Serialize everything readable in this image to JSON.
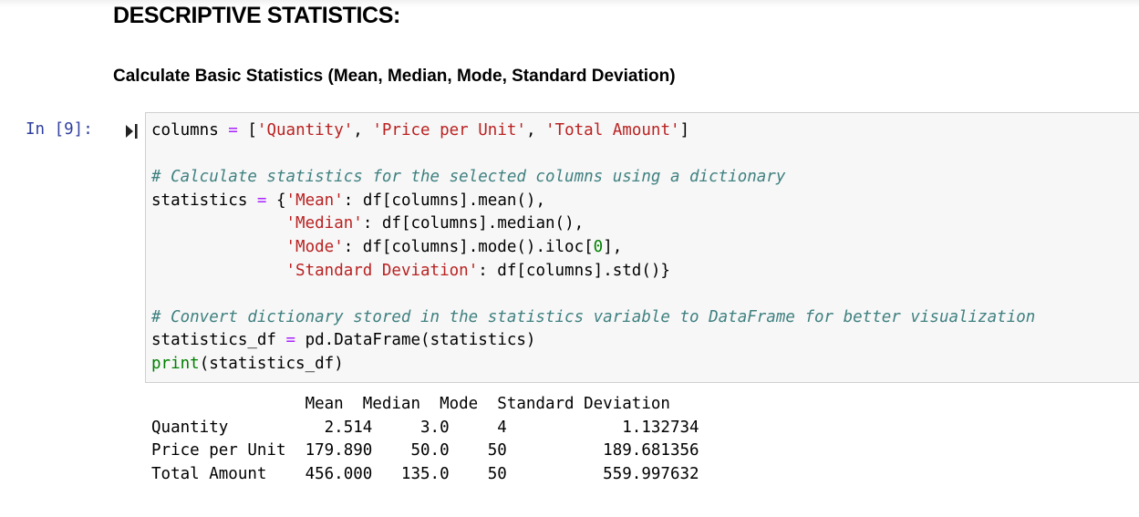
{
  "markdown": {
    "heading": "DESCRIPTIVE STATISTICS:",
    "subheading": "Calculate Basic Statistics (Mean, Median, Mode, Standard Deviation)"
  },
  "cell": {
    "prompt": "In [9]:",
    "run_icon": "run-cell-icon",
    "code": {
      "l1": [
        "columns ",
        "=",
        " [",
        "'Quantity'",
        ", ",
        "'Price per Unit'",
        ", ",
        "'Total Amount'",
        "]"
      ],
      "l3": "# Calculate statistics for the selected columns using a dictionary",
      "l4": [
        "statistics ",
        "=",
        " {",
        "'Mean'",
        ": df[columns].mean(),"
      ],
      "l5": [
        "              ",
        "'Median'",
        ": df[columns].median(),"
      ],
      "l6": [
        "              ",
        "'Mode'",
        ": df[columns].mode().iloc[",
        "0",
        "],"
      ],
      "l7": [
        "              ",
        "'Standard Deviation'",
        ": df[columns].std()}"
      ],
      "l9": "# Convert dictionary stored in the statistics variable to DataFrame for better visualization",
      "l10": [
        "statistics_df ",
        "=",
        " pd.DataFrame(statistics)"
      ],
      "l11": [
        "print",
        "(statistics_df)"
      ]
    },
    "output": {
      "header": "                Mean  Median  Mode  Standard Deviation",
      "rows": [
        "Quantity          2.514     3.0     4            1.132734",
        "Price per Unit  179.890    50.0    50          189.681356",
        "Total Amount    456.000   135.0    50          559.997632"
      ]
    }
  },
  "colors": {
    "prompt": "#303f9f",
    "string": "#ba2121",
    "comment": "#408080",
    "operator": "#aa22ff",
    "number": "#008000",
    "code_background": "#f7f7f7"
  }
}
